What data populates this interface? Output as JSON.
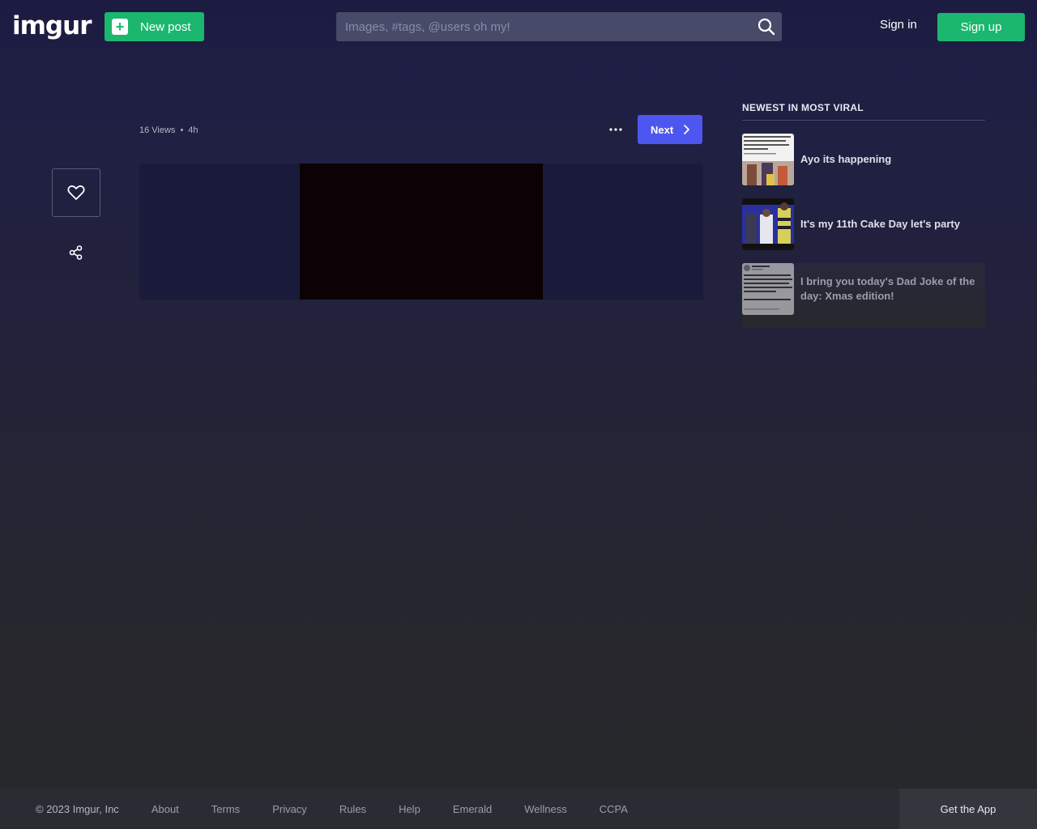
{
  "header": {
    "logo_text": "imgur",
    "new_post_label": "New post",
    "search_placeholder": "Images, #tags, @users oh my!",
    "sign_in_label": "Sign in",
    "sign_up_label": "Sign up"
  },
  "post": {
    "views": "16 Views",
    "separator": "•",
    "age": "4h",
    "next_label": "Next"
  },
  "sidebar": {
    "title": "NEWEST IN MOST VIRAL",
    "items": [
      {
        "title": "Ayo its happening"
      },
      {
        "title": "It's my 11th Cake Day let's party"
      },
      {
        "title": "I bring you today's Dad Joke of the day: Xmas edition!"
      }
    ]
  },
  "footer": {
    "copyright": "© 2023 Imgur, Inc",
    "links": [
      "About",
      "Terms",
      "Privacy",
      "Rules",
      "Help",
      "Emerald",
      "Wellness",
      "CCPA"
    ],
    "get_app_label": "Get the App"
  },
  "colors": {
    "brand_green": "#1bb76e",
    "accent_blue": "#4e56f0",
    "search_bg": "#474a69"
  }
}
